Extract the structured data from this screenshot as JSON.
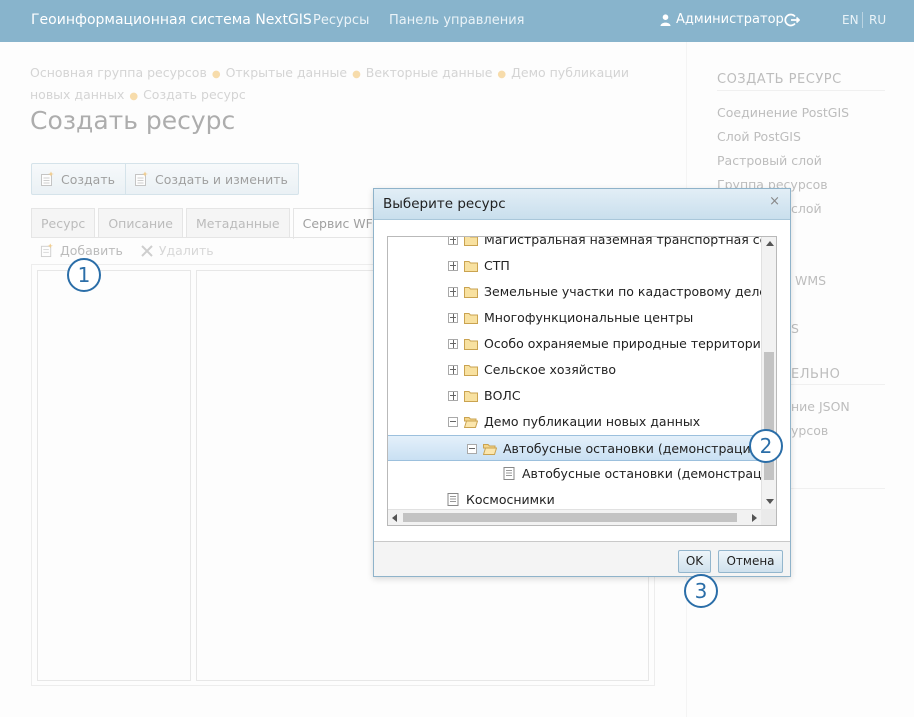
{
  "header": {
    "brand": "Геоинформационная система NextGIS",
    "nav": [
      "Ресурсы",
      "Панель управления"
    ],
    "user": "Администратор",
    "lang_en": "EN",
    "lang_ru": "RU"
  },
  "breadcrumb": {
    "items": [
      "Основная группа ресурсов",
      "Открытые данные",
      "Векторные данные",
      "Демо публикации новых данных",
      "Создать ресурс"
    ]
  },
  "page_title": "Создать ресурс",
  "buttons": {
    "create": "Создать",
    "create_edit": "Создать и изменить"
  },
  "tabs": [
    "Ресурс",
    "Описание",
    "Метаданные",
    "Сервис WFS"
  ],
  "toolbar": {
    "add": "Добавить",
    "remove": "Удалить"
  },
  "sidebar": {
    "title": "СОЗДАТЬ РЕСУРС",
    "links": [
      "Соединение PostGIS",
      "Слой PostGIS",
      "Растровый слой",
      "Группа ресурсов",
      "слой",
      "WMS",
      "S"
    ],
    "title2": "ЕЛЬНО",
    "links2": [
      "ние JSON",
      "урсов"
    ]
  },
  "dialog": {
    "title": "Выберите ресурс",
    "close": "×",
    "tree": [
      {
        "label": "Магистральная наземная транспортная сеть",
        "type": "folder",
        "level": 1,
        "expander": "plus"
      },
      {
        "label": "СТП",
        "type": "folder",
        "level": 1,
        "expander": "plus"
      },
      {
        "label": "Земельные участки по кадастровому делению",
        "type": "folder",
        "level": 1,
        "expander": "plus"
      },
      {
        "label": "Многофункциональные центры",
        "type": "folder",
        "level": 1,
        "expander": "plus"
      },
      {
        "label": "Особо охраняемые природные территории",
        "type": "folder",
        "level": 1,
        "expander": "plus"
      },
      {
        "label": "Сельское хозяйство",
        "type": "folder",
        "level": 1,
        "expander": "plus"
      },
      {
        "label": "ВОЛС",
        "type": "folder",
        "level": 1,
        "expander": "plus"
      },
      {
        "label": "Демо публикации новых данных",
        "type": "folder-open",
        "level": 1,
        "expander": "minus"
      },
      {
        "label": "Автобусные остановки (демонстрация)",
        "type": "folder-open",
        "level": 2,
        "expander": "minus",
        "selected": true
      },
      {
        "label": "Автобусные остановки (демонстрация",
        "type": "doc",
        "level": 3
      },
      {
        "label": "Космоснимки",
        "type": "doc",
        "level": 0
      }
    ],
    "ok": "OK",
    "cancel": "Отмена"
  },
  "callouts": [
    "1",
    "2",
    "3"
  ],
  "colors": {
    "header": "#88b4cc",
    "callout": "#2b6ea8",
    "selected_row": "#c9e0f3"
  }
}
